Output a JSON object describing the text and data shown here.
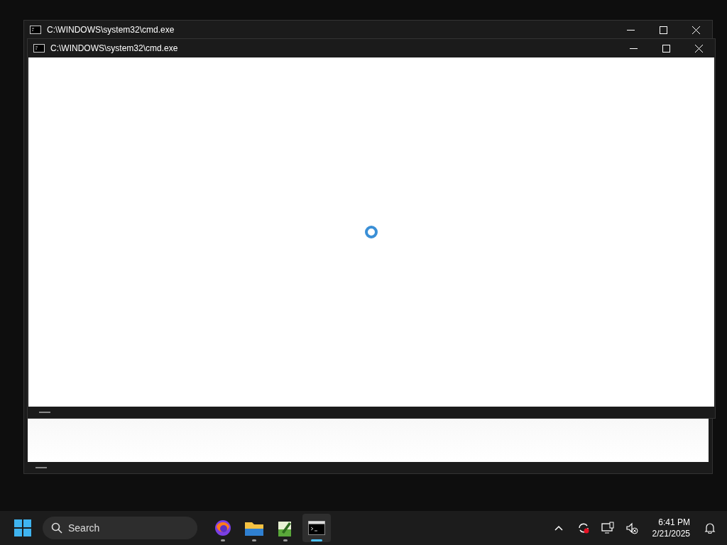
{
  "windows": [
    {
      "title": "C:\\WINDOWS\\system32\\cmd.exe"
    },
    {
      "title": "C:\\WINDOWS\\system32\\cmd.exe",
      "loading": true
    }
  ],
  "taskbar": {
    "search": {
      "placeholder": "Search"
    },
    "apps": [
      {
        "kind": "browser",
        "selected": false
      },
      {
        "kind": "folder",
        "selected": false
      },
      {
        "kind": "editor",
        "selected": false
      },
      {
        "kind": "terminal",
        "selected": true
      }
    ],
    "clock": {
      "time": "6:41 PM",
      "date": "2/21/2025"
    }
  }
}
